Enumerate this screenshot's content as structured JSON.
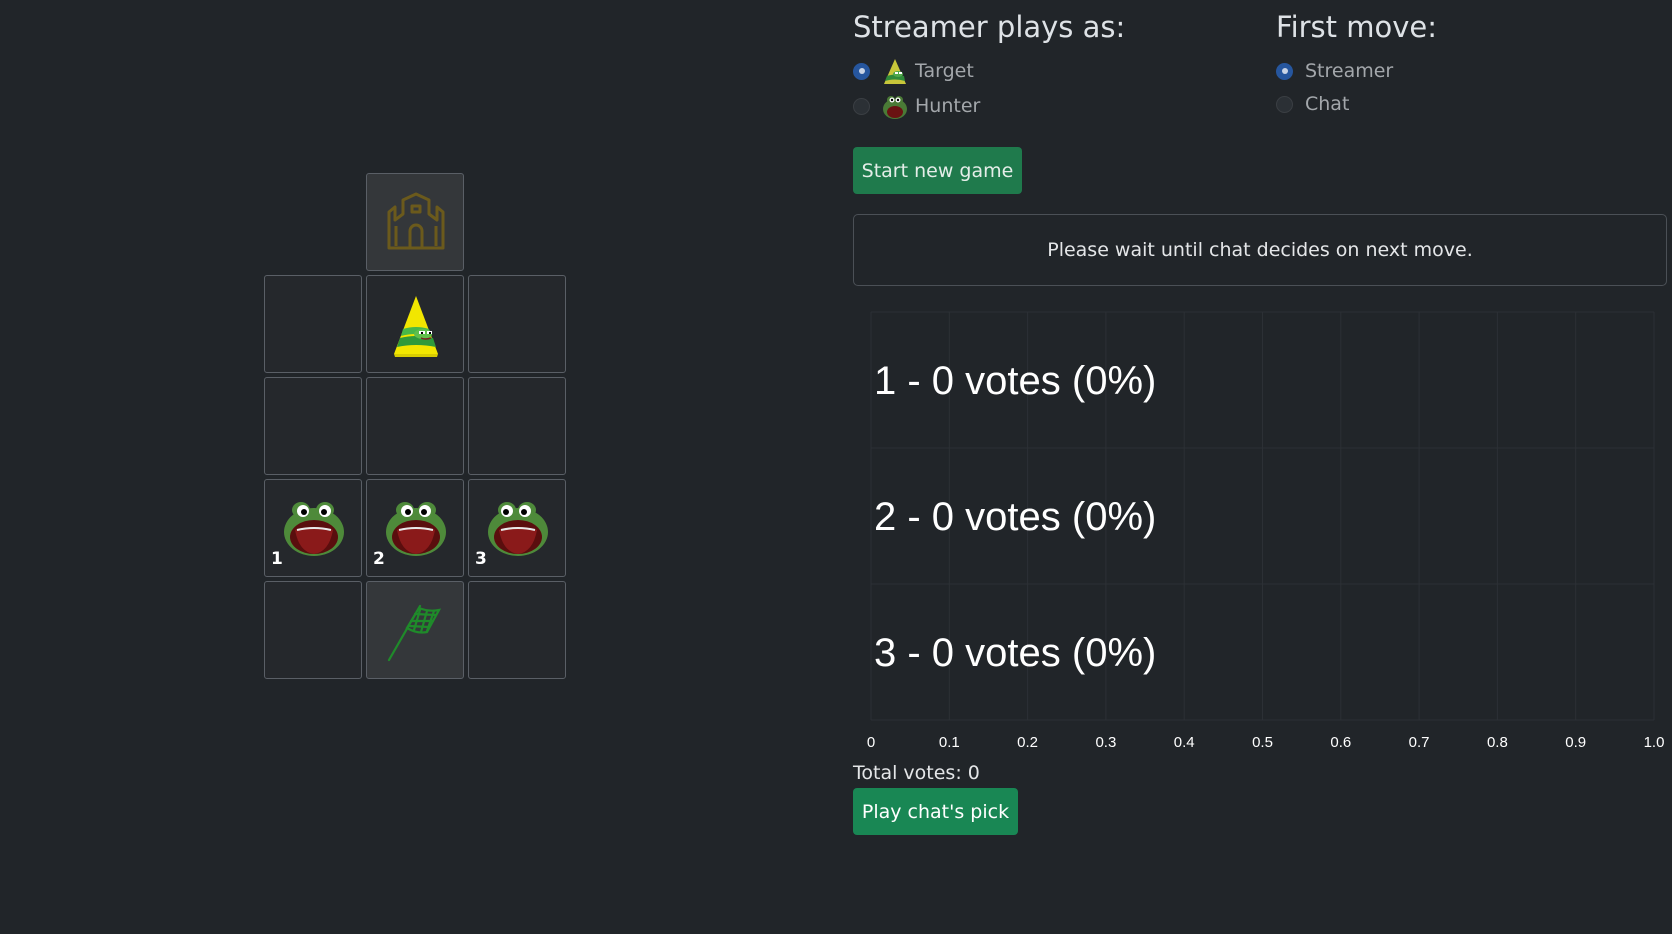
{
  "settings": {
    "streamer_heading": "Streamer plays as:",
    "streamer_options": [
      {
        "label": "Target",
        "checked": true,
        "icon": "pyramid-frog-icon"
      },
      {
        "label": "Hunter",
        "checked": false,
        "icon": "frog-face-icon"
      }
    ],
    "first_move_heading": "First move:",
    "first_move_options": [
      {
        "label": "Streamer",
        "checked": true
      },
      {
        "label": "Chat",
        "checked": false
      }
    ]
  },
  "buttons": {
    "start_new_game": "Start new game",
    "play_chats_pick": "Play chat's pick"
  },
  "status": {
    "message": "Please wait until chat decides on next move."
  },
  "board": {
    "goal_icon": "castle-icon",
    "target_icon": "pyramid-frog-icon",
    "hunter_icon": "laughing-frog-icon",
    "start_icon": "checkered-flag-icon",
    "hunter_numbers": [
      "1",
      "2",
      "3"
    ]
  },
  "chart_data": {
    "type": "bar",
    "orientation": "horizontal",
    "categories": [
      "1",
      "2",
      "3"
    ],
    "values": [
      0,
      0,
      0
    ],
    "bar_labels": [
      "1 - 0 votes (0%)",
      "2 - 0 votes (0%)",
      "3 - 0 votes (0%)"
    ],
    "xlim": [
      0,
      1.0
    ],
    "xticks": [
      "0",
      "0.1",
      "0.2",
      "0.3",
      "0.4",
      "0.5",
      "0.6",
      "0.7",
      "0.8",
      "0.9",
      "1.0"
    ],
    "grid": true
  },
  "totals": {
    "total_votes_text": "Total votes: 0"
  },
  "colors": {
    "background": "#212529",
    "button_green": "#198754",
    "radio_checked": "#26569e",
    "goal_gold": "#6b5a1c",
    "flag_green": "#1f8a2a"
  }
}
